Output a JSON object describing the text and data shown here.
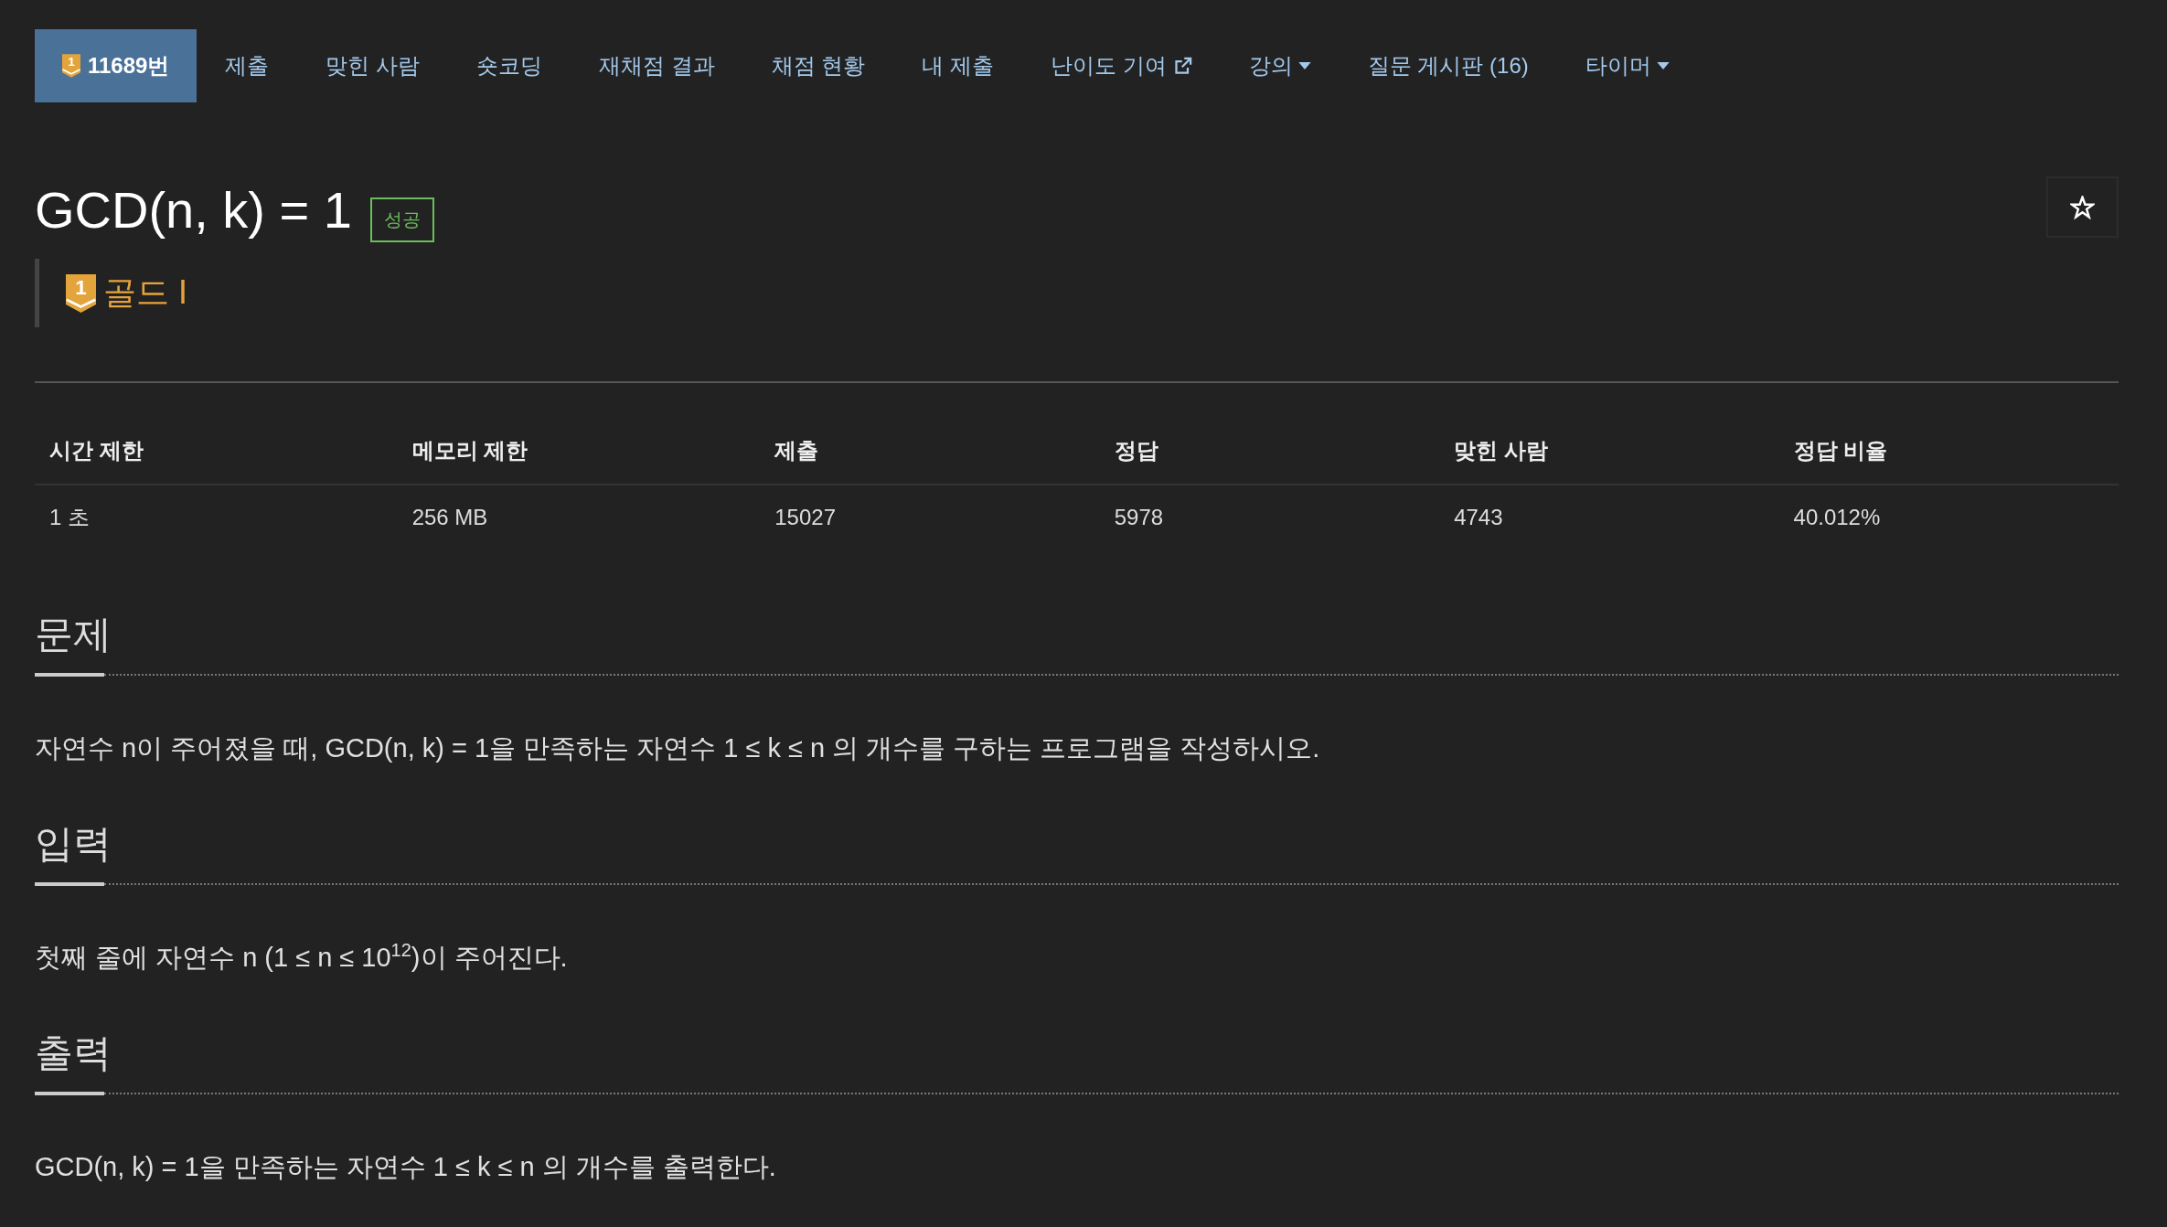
{
  "nav": {
    "tabs": [
      {
        "label": "11689번",
        "kind": "problem",
        "tier_badge": "1",
        "selected": true
      },
      {
        "label": "제출",
        "kind": "link",
        "selected": false
      },
      {
        "label": "맞힌 사람",
        "kind": "link",
        "selected": false
      },
      {
        "label": "숏코딩",
        "kind": "link",
        "selected": false
      },
      {
        "label": "재채점 결과",
        "kind": "link",
        "selected": false
      },
      {
        "label": "채점 현황",
        "kind": "link",
        "selected": false
      },
      {
        "label": "내 제출",
        "kind": "link",
        "selected": false
      },
      {
        "label": "난이도 기여",
        "kind": "external",
        "selected": false
      },
      {
        "label": "강의",
        "kind": "dropdown",
        "selected": false
      },
      {
        "label": "질문 게시판 (16)",
        "kind": "link",
        "selected": false
      },
      {
        "label": "타이머",
        "kind": "dropdown",
        "selected": false
      }
    ]
  },
  "problem": {
    "title": "GCD(n, k) = 1",
    "result_badge": "성공",
    "tier": {
      "badge": "1",
      "label": "골드 I"
    }
  },
  "stats": {
    "columns": [
      "시간 제한",
      "메모리 제한",
      "제출",
      "정답",
      "맞힌 사람",
      "정답 비율"
    ],
    "rows": [
      [
        "1 초",
        "256 MB",
        "15027",
        "5978",
        "4743",
        "40.012%"
      ]
    ]
  },
  "sections": [
    {
      "heading": "문제",
      "body": "자연수 n이 주어졌을 때, GCD(n, k) = 1을 만족하는 자연수 1 ≤ k ≤ n 의 개수를 구하는 프로그램을 작성하시오."
    },
    {
      "heading": "입력",
      "body": "첫째 줄에 자연수 n (1 ≤ n ≤ 10$^{12}$)이 주어진다."
    },
    {
      "heading": "출력",
      "body": "GCD(n, k) = 1을 만족하는 자연수 1 ≤ k ≤ n 의 개수를 출력한다."
    }
  ]
}
